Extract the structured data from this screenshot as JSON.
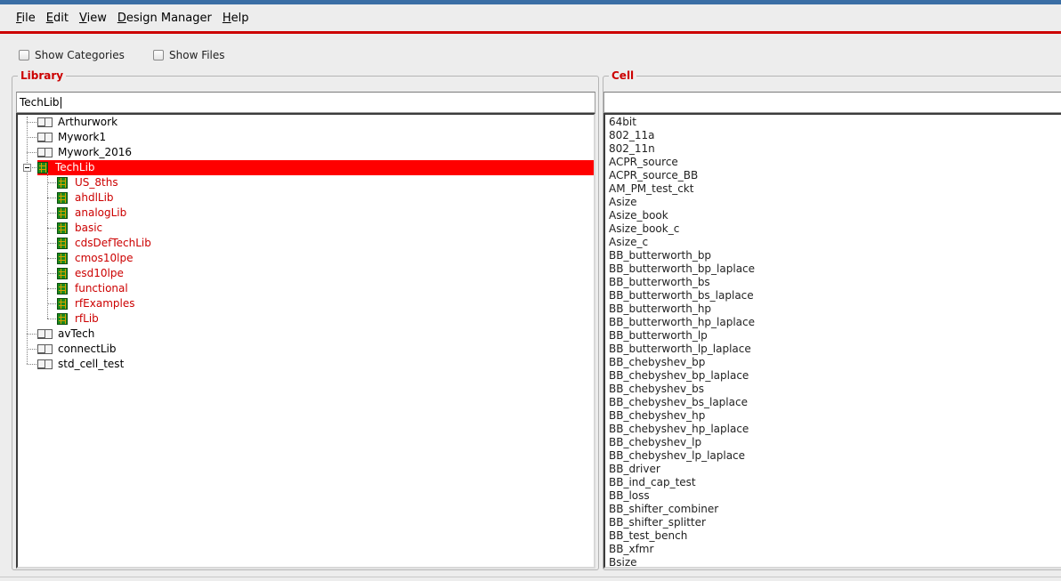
{
  "menu": {
    "items": [
      {
        "mnemonic": "F",
        "rest": "ile"
      },
      {
        "mnemonic": "E",
        "rest": "dit"
      },
      {
        "mnemonic": "V",
        "rest": "iew"
      },
      {
        "mnemonic": "D",
        "rest": "esign Manager"
      },
      {
        "mnemonic": "H",
        "rest": "elp"
      }
    ]
  },
  "options": {
    "show_categories": "Show Categories",
    "show_files": "Show Files"
  },
  "library": {
    "title": "Library",
    "filter_value": "TechLib",
    "tree": [
      {
        "label": "Arthurwork",
        "icon": "book-icon",
        "level": 0
      },
      {
        "label": "Mywork1",
        "icon": "book-icon",
        "level": 0
      },
      {
        "label": "Mywork_2016",
        "icon": "book-icon",
        "level": 0
      },
      {
        "label": "TechLib",
        "icon": "library-icon",
        "level": 0,
        "selected": true,
        "expanded": true
      },
      {
        "label": "US_8ths",
        "icon": "library-icon",
        "level": 1
      },
      {
        "label": "ahdlLib",
        "icon": "library-icon",
        "level": 1
      },
      {
        "label": "analogLib",
        "icon": "library-icon",
        "level": 1
      },
      {
        "label": "basic",
        "icon": "library-icon",
        "level": 1
      },
      {
        "label": "cdsDefTechLib",
        "icon": "library-icon",
        "level": 1
      },
      {
        "label": "cmos10lpe",
        "icon": "library-icon",
        "level": 1
      },
      {
        "label": "esd10lpe",
        "icon": "library-icon",
        "level": 1
      },
      {
        "label": "functional",
        "icon": "library-icon",
        "level": 1
      },
      {
        "label": "rfExamples",
        "icon": "library-icon",
        "level": 1
      },
      {
        "label": "rfLib",
        "icon": "library-icon",
        "level": 1
      },
      {
        "label": "avTech",
        "icon": "book-icon",
        "level": 0
      },
      {
        "label": "connectLib",
        "icon": "book-icon",
        "level": 0
      },
      {
        "label": "std_cell_test",
        "icon": "book-icon",
        "level": 0
      }
    ]
  },
  "cell": {
    "title": "Cell",
    "filter_value": "",
    "items": [
      "64bit",
      "802_11a",
      "802_11n",
      "ACPR_source",
      "ACPR_source_BB",
      "AM_PM_test_ckt",
      "Asize",
      "Asize_book",
      "Asize_book_c",
      "Asize_c",
      "BB_butterworth_bp",
      "BB_butterworth_bp_laplace",
      "BB_butterworth_bs",
      "BB_butterworth_bs_laplace",
      "BB_butterworth_hp",
      "BB_butterworth_hp_laplace",
      "BB_butterworth_lp",
      "BB_butterworth_lp_laplace",
      "BB_chebyshev_bp",
      "BB_chebyshev_bp_laplace",
      "BB_chebyshev_bs",
      "BB_chebyshev_bs_laplace",
      "BB_chebyshev_hp",
      "BB_chebyshev_hp_laplace",
      "BB_chebyshev_lp",
      "BB_chebyshev_lp_laplace",
      "BB_driver",
      "BB_ind_cap_test",
      "BB_loss",
      "BB_shifter_combiner",
      "BB_shifter_splitter",
      "BB_test_bench",
      "BB_xfmr",
      "Bsize"
    ]
  },
  "colors": {
    "accent": "#cc0000",
    "selection": "#ff0000",
    "child_text": "#cc0000"
  }
}
